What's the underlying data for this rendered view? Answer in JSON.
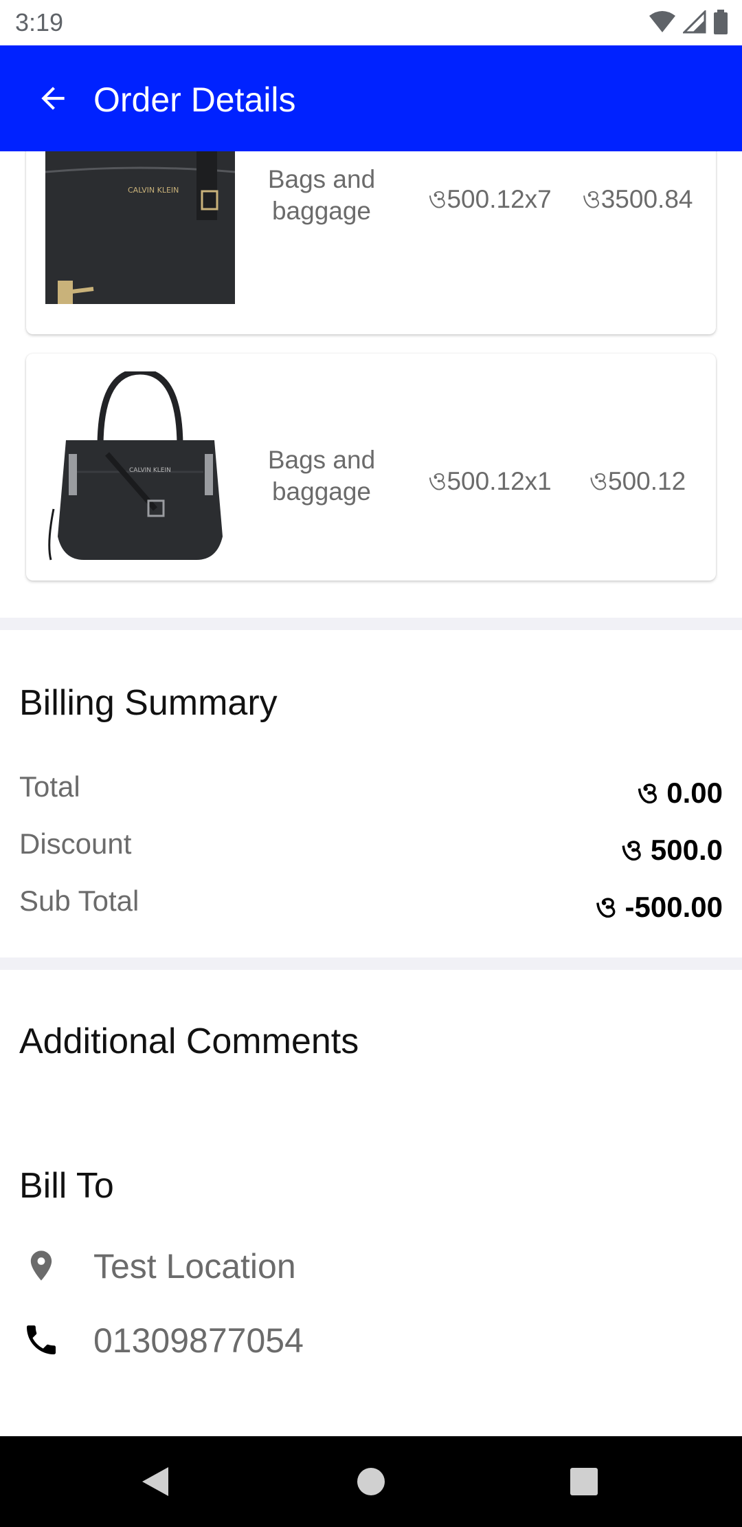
{
  "status_bar": {
    "time": "3:19",
    "icons": [
      "wifi-icon",
      "signal-icon",
      "battery-icon"
    ]
  },
  "app_bar": {
    "title": "Order Details",
    "back_icon": "arrow-back-icon",
    "color": "#0022ff"
  },
  "items": [
    {
      "name": "Bags and baggage",
      "qty_price": "ও500.12x7",
      "total": "ও3500.84",
      "image": "black-crossbody-bag"
    },
    {
      "name": "Bags and baggage",
      "qty_price": "ও500.12x1",
      "total": "ও500.12",
      "image": "black-shoulder-bag"
    }
  ],
  "billing": {
    "title": "Billing Summary",
    "rows": [
      {
        "label": "Total",
        "value": "ও 0.00"
      },
      {
        "label": "Discount",
        "value": "ও 500.0"
      },
      {
        "label": "Sub Total",
        "value": "ও -500.00"
      }
    ]
  },
  "comments": {
    "title": "Additional Comments"
  },
  "bill_to": {
    "title": "Bill To",
    "location": "Test Location",
    "phone": "01309877054",
    "location_icon": "location-pin-icon",
    "phone_icon": "phone-icon"
  },
  "nav_bar": {
    "buttons": [
      "nav-back-icon",
      "nav-home-icon",
      "nav-recents-icon"
    ]
  }
}
